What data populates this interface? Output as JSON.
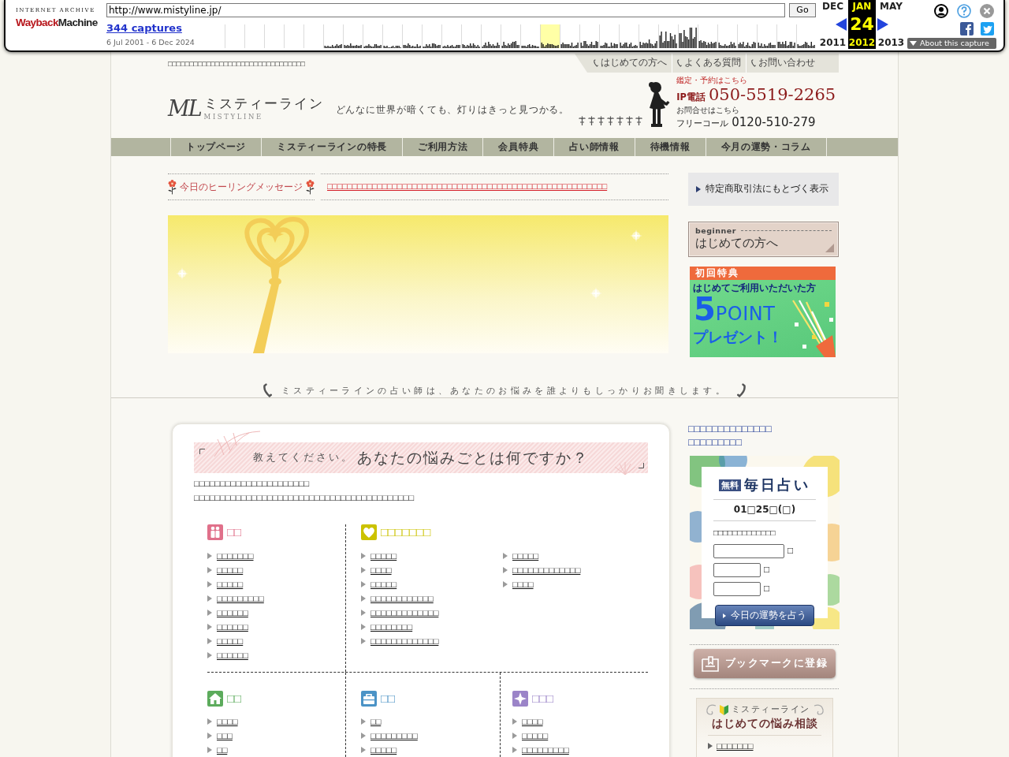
{
  "wayback": {
    "logo_caption": "INTERNET ARCHIVE",
    "logo": [
      "Wayback",
      "Machine"
    ],
    "url": "http://www.mistyline.jp/",
    "go_button": "Go",
    "captures": "344 captures",
    "date_range": "6 Jul 2001 - 6 Dec 2024",
    "months": [
      {
        "month": "DEC",
        "year": "2011",
        "selected": false
      },
      {
        "month": "JAN",
        "day": "24",
        "year": "2012",
        "selected": true
      },
      {
        "month": "MAY",
        "year": "2013",
        "selected": false
      }
    ],
    "about_button": "About this capture"
  },
  "header": {
    "notice": "□□□□□□□□□□□□□□□□□□□□□□□□□□□□□□□□",
    "top_links": [
      "はじめての方へ",
      "よくある質問",
      "お問い合わせ"
    ],
    "monogram": "ML",
    "site_name": "ミスティーライン",
    "site_name_latin": "MISTYLINE",
    "tagline": "どんなに世界が暗くても、灯りはきっと見つかる。",
    "reservation": {
      "caption": "鑑定・予約はこちら",
      "label": "IP電話",
      "number": "050-5519-2265"
    },
    "inquiry": {
      "caption": "お問合せはこちら",
      "label": "フリーコール",
      "number": "0120-510-279"
    }
  },
  "nav": [
    "トップページ",
    "ミスティーラインの特長",
    "ご利用方法",
    "会員特典",
    "占い師情報",
    "待機情報",
    "今月の運勢・コラム"
  ],
  "message": {
    "label": "今日のヒーリングメッセージ",
    "text": "□□□□□□□□□□□□□□□□□□□□□□□□□□□□□□□□□□□□□□□□□□□□□□□□□□□□□□□□"
  },
  "side_banners": {
    "legal_link": "特定商取引法にもとづく表示",
    "beginner": {
      "caption": "beginner",
      "title": "はじめての方へ"
    },
    "bonus": {
      "heading": "初回特典",
      "subtitle": "はじめてご利用いただいた方",
      "points": "5",
      "points_unit": "POINT",
      "present": "プレゼント！"
    }
  },
  "tagline": "ミスティーラインの占い師は、あなたのお悩みを誰よりもしっかりお聞きします。",
  "consult": {
    "title_lead": "教えてください。",
    "title": "あなたの悩みごとは何ですか？",
    "intro": [
      "□□□□□□□□□□□□□□□□□□□□□□",
      "□□□□□□□□□□□□□□□□□□□□□□□□□□□□□□□□□□□□□□□□□□"
    ],
    "category_rows": [
      [
        {
          "kind": "couple",
          "color": "#e0708a",
          "title": "□□",
          "columns": [
            [
              "□□□□□□□",
              "□□□□□",
              "□□□□□",
              "□□□□□□□□□",
              "□□□□□□",
              "□□□□□□",
              "□□□□□",
              "□□□□□□"
            ]
          ]
        },
        {
          "kind": "heart",
          "color": "#cbc200",
          "title": "□□□□□□□",
          "columns": [
            [
              "□□□□□",
              "□□□□",
              "□□□□□",
              "□□□□□□□□□□□□",
              "□□□□□□□□□□□□□",
              "□□□□□□□□",
              "□□□□□□□□□□□□□"
            ],
            [
              "□□□□□",
              "□□□□□□□□□□□□□",
              "□□□□"
            ]
          ]
        }
      ],
      [
        {
          "kind": "house",
          "color": "#5cab5c",
          "title": "□□",
          "columns": [
            [
              "□□□□",
              "□□□",
              "□□"
            ]
          ]
        },
        {
          "kind": "briefcase",
          "color": "#4b93c6",
          "title": "□□",
          "columns": [
            [
              "□□",
              "□□□□□□□□□",
              "□□□□□"
            ]
          ]
        },
        {
          "kind": "sparkle",
          "color": "#9b84c8",
          "title": "□□□",
          "columns": [
            [
              "□□□□",
              "□□□□□",
              "□□□□□□□□□"
            ]
          ]
        }
      ]
    ]
  },
  "sidebar": {
    "notice": [
      "□□□□□□□□□□□□□□",
      "□□□□□□□□□"
    ],
    "fortune": {
      "badge": "無料",
      "title": "毎日占い",
      "date": "01□25□(□)",
      "prompt": "□□□□□□□□□□□□□",
      "fields": [
        {
          "unit": "□"
        },
        {
          "unit": "□"
        },
        {
          "unit": "□"
        }
      ],
      "button": "今日の運勢を占う"
    },
    "bookmark_button": "ブックマークに登録",
    "guide": {
      "caption": "ミスティーライン",
      "title": "はじめての悩み相談",
      "items": [
        "□□□□□□□"
      ]
    }
  }
}
